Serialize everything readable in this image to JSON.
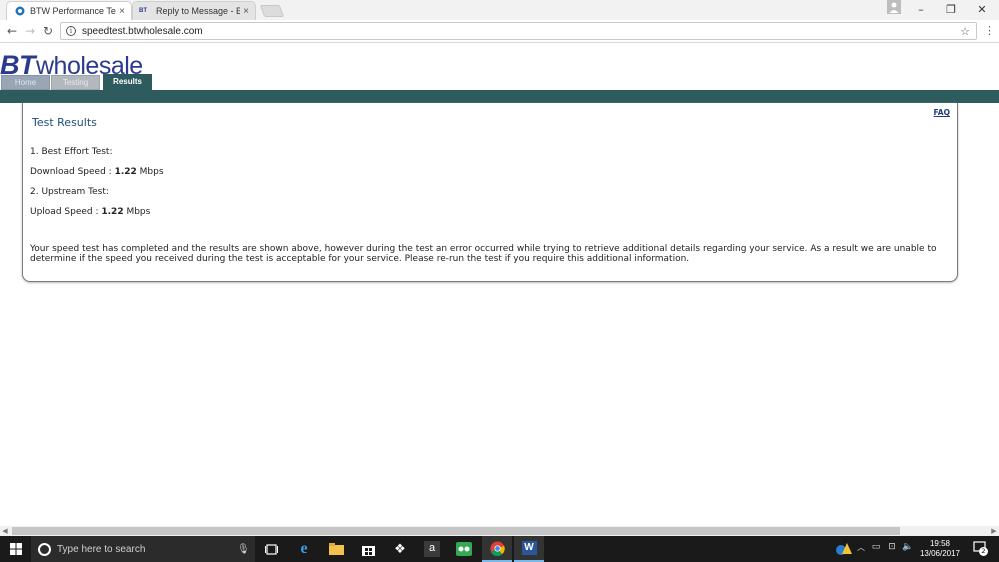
{
  "browser": {
    "tabs": [
      {
        "title": "BTW Performance Test",
        "active": true
      },
      {
        "title": "Reply to Message - BTC",
        "active": false
      }
    ],
    "tab_close": "×",
    "url": "speedtest.btwholesale.com",
    "window_controls": {
      "minimize": "–",
      "restore": "❐",
      "close": "✕"
    }
  },
  "site": {
    "logo_bt": "BT",
    "logo_wholesale": "wholesale",
    "nav": {
      "home": "Home",
      "testing": "Testing",
      "results": "Results"
    },
    "brand_color": "#2e5b5e",
    "logo_color": "#2b3a8f"
  },
  "results": {
    "title": "Test Results",
    "faq": "FAQ",
    "best_effort_heading": "1. Best Effort Test:",
    "download_label": "Download Speed : ",
    "download_value": "1.22",
    "download_unit": " Mbps",
    "upstream_heading": "2. Upstream Test:",
    "upload_label": "Upload Speed : ",
    "upload_value": "1.22",
    "upload_unit": " Mbps",
    "notice": "Your speed test has completed and the results are shown above, however during the test an error occurred while trying to retrieve additional details regarding your service. As a result we are unable to determine if the speed you received during the test is acceptable for your service. Please re-run the test if you require this additional information."
  },
  "taskbar": {
    "search_placeholder": "Type here to search",
    "time": "19:58",
    "date": "13/06/2017",
    "notification_count": "2"
  }
}
